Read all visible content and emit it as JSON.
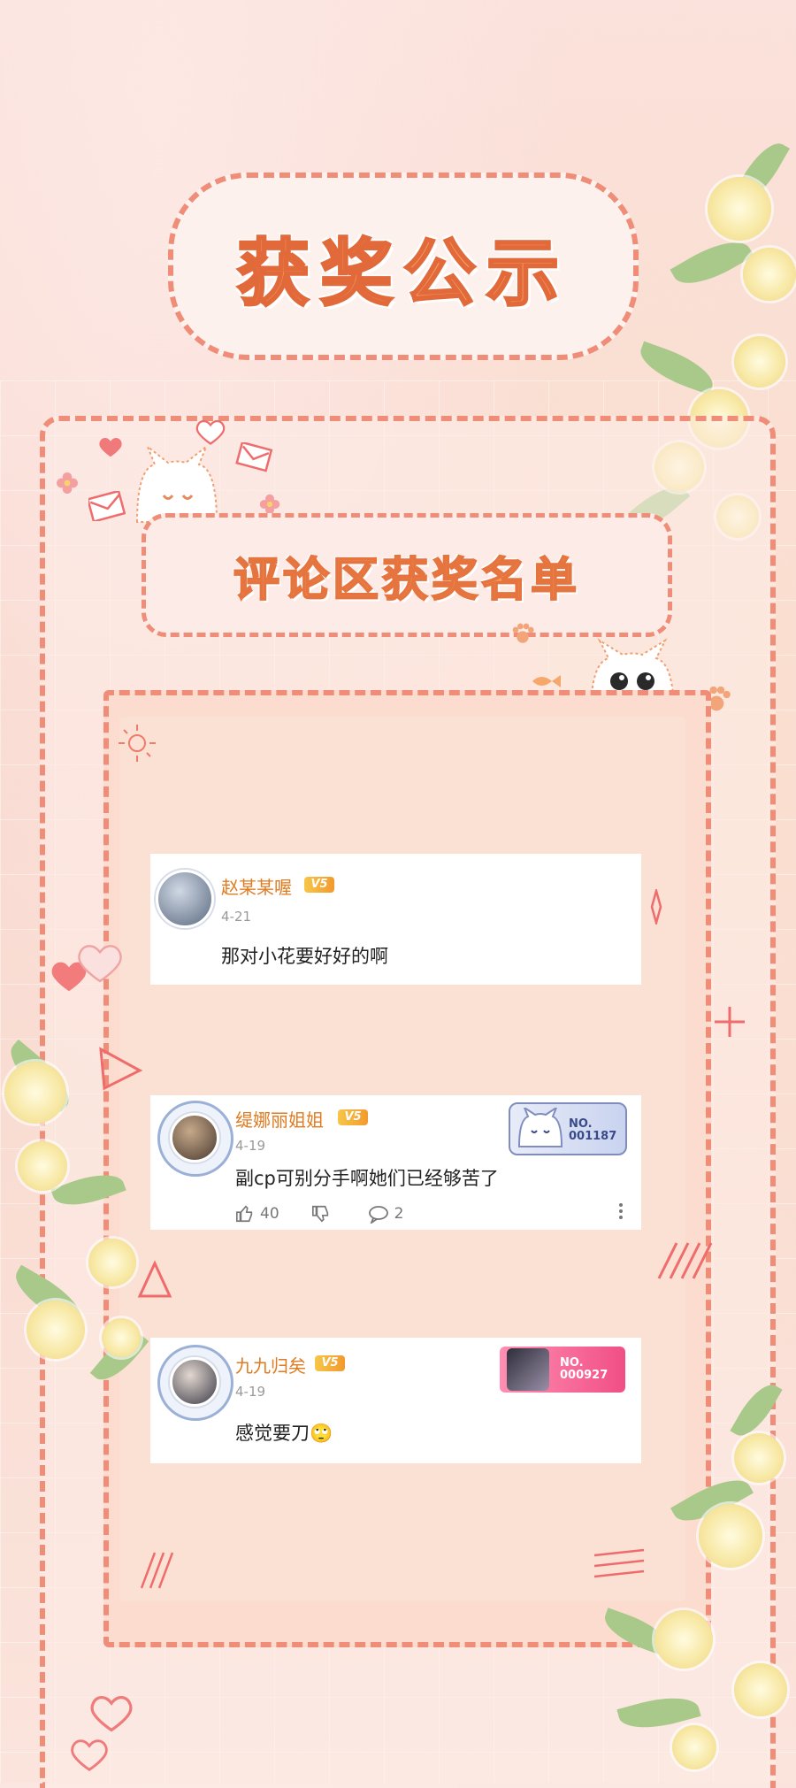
{
  "title": "获奖公示",
  "subtitle": "评论区获奖名单",
  "colors": {
    "accent": "#ef8d78",
    "title_fill": "#f2955a",
    "username": "#e07b20",
    "background": "#fbe2dc"
  },
  "comments": [
    {
      "username": "赵某某喔",
      "vip": "V5",
      "date": "4-21",
      "text": "那对小花要好好的啊"
    },
    {
      "username": "缇娜丽姐姐",
      "vip": "V5",
      "date": "4-19",
      "text": "副cp可别分手啊她们已经够苦了",
      "badge": "NO.\n001187",
      "likes": "40",
      "replies": "2"
    },
    {
      "username": "九九归矣",
      "vip": "V5",
      "date": "4-19",
      "text": "感觉要刀",
      "emoji": "🙄",
      "badge": "NO.\n000927"
    }
  ],
  "icons": [
    "heart-icon",
    "envelope-icon",
    "cat-icon",
    "flower-icon",
    "like-icon",
    "dislike-icon",
    "comment-icon",
    "more-icon",
    "sparkle-icon",
    "triangle-icon"
  ]
}
